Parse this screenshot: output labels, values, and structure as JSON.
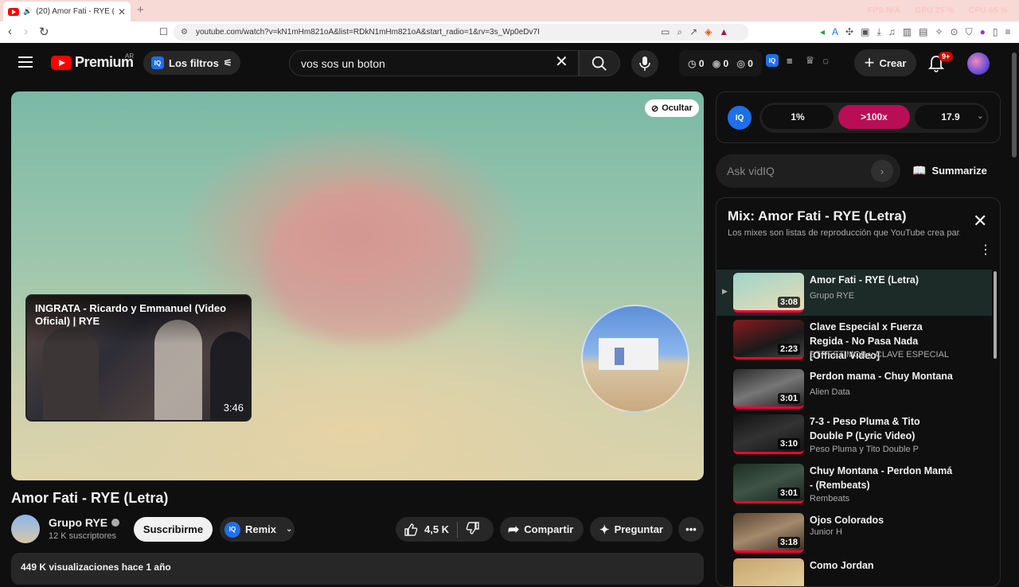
{
  "browser": {
    "tab_title": "(20) Amor Fati - RYE (Letra) -",
    "url": "youtube.com/watch?v=kN1mHm821oA&list=RDkN1mHm821oA&start_radio=1&rv=3s_Wp0eDv7I",
    "stats": [
      "FPS N/A",
      "GPU 25 %",
      "CPU 65 %"
    ]
  },
  "header": {
    "logo_text": "Premium",
    "country": "AR",
    "filters_label": "Los filtros",
    "search_value": "vos sos un boton",
    "counters": [
      "0",
      "0",
      "0"
    ],
    "create_label": "Crear",
    "notif_badge": "9+"
  },
  "player": {
    "hide_label": "Ocultar",
    "endcard_title": "INGRATA - Ricardo y Emmanuel (Video Oficial) | RYE",
    "endcard_duration": "3:46"
  },
  "video": {
    "title": "Amor Fati - RYE (Letra)",
    "channel": "Grupo RYE",
    "subscribers": "12 K suscriptores",
    "subscribe_label": "Suscribirme",
    "remix_label": "Remix",
    "likes": "4,5 K",
    "share_label": "Compartir",
    "ask_label": "Preguntar",
    "description_meta": "449 K visualizaciones  hace 1 año"
  },
  "vidiq": {
    "logo": "IQ",
    "scores": [
      "1%",
      ">100x",
      "17.9"
    ],
    "ask_placeholder": "Ask vidIQ",
    "summarize_label": "Summarize"
  },
  "mix": {
    "title": "Mix: Amor Fati - RYE (Letra)",
    "subtitle": "Los mixes son listas de reproducción que YouTube crea par...",
    "items": [
      {
        "title": "Amor Fati - RYE (Letra)",
        "channel": "Grupo RYE",
        "duration": "3:08"
      },
      {
        "title": "Clave Especial x Fuerza Regida - No Pasa Nada [Official Video]",
        "channel": "STREET MOB y CLAVE ESPECIAL",
        "duration": "2:23"
      },
      {
        "title": "Perdon mama - Chuy Montana",
        "channel": "Alien Data",
        "duration": "3:01"
      },
      {
        "title": "7-3 - Peso Pluma & Tito Double P (Lyric Video)",
        "channel": "Peso Pluma y Tito Double P",
        "duration": "3:10"
      },
      {
        "title": "Chuy Montana - Perdon Mamá - (Rembeats)",
        "channel": "Rembeats",
        "duration": "3:01"
      },
      {
        "title": "Ojos Colorados",
        "channel": "Junior H",
        "duration": "3:18"
      },
      {
        "title": "Como Jordan",
        "channel": "",
        "duration": ""
      }
    ]
  },
  "colors": {
    "accent_red": "#ff0033",
    "vidiq_blue": "#1f6feb",
    "score_hot": "#b80e55"
  }
}
